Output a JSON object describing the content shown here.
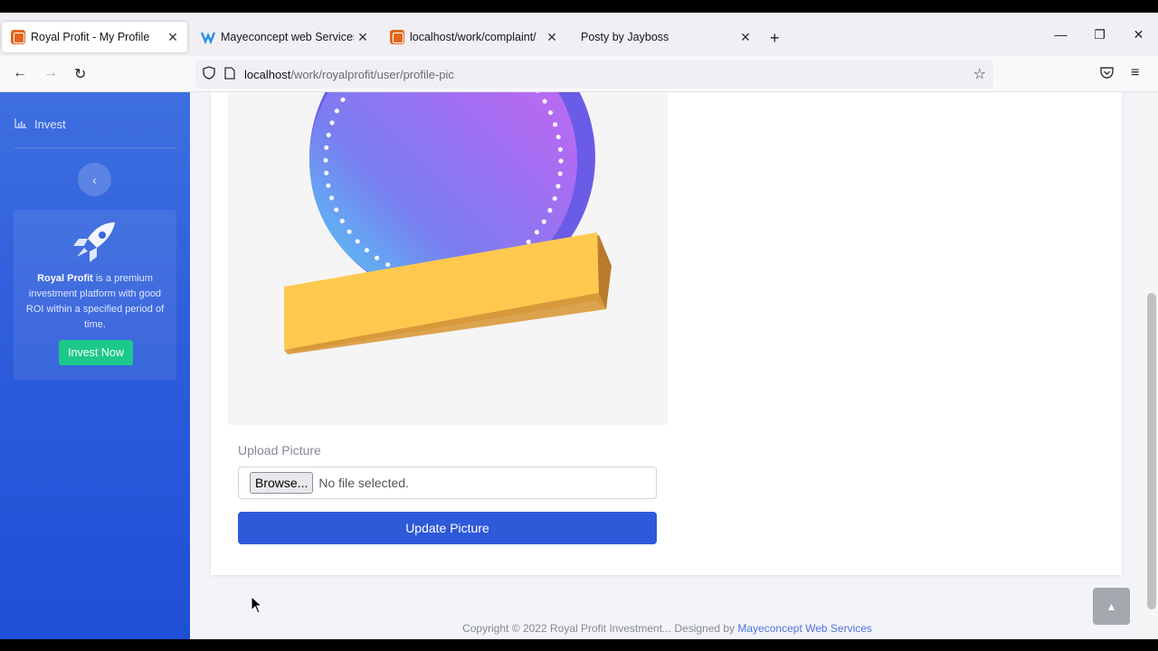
{
  "browser": {
    "tabs": [
      {
        "title": "Royal Profit - My Profile",
        "active": true
      },
      {
        "title": "Mayeconcept web Services",
        "active": false
      },
      {
        "title": "localhost/work/complaint/",
        "active": false
      },
      {
        "title": "Posty by Jayboss",
        "active": false
      }
    ],
    "url_host": "localhost",
    "url_path": "/work/royalprofit/user/profile-pic"
  },
  "sidebar": {
    "invest_label": "Invest",
    "promo_brand": "Royal Profit",
    "promo_text": " is a premium investment platform with good ROI within a specified period of time.",
    "promo_button": "Invest Now"
  },
  "form": {
    "upload_label": "Upload Picture",
    "browse_label": "Browse...",
    "file_status": "No file selected.",
    "submit_label": "Update Picture"
  },
  "footer": {
    "text": "Copyright © 2022 Royal Profit Investment... Designed by ",
    "link": "Mayeconcept Web Services"
  },
  "colors": {
    "sidebar": "#2f5fdc",
    "primary_button": "#2e59d9",
    "success_button": "#1cc88a"
  }
}
